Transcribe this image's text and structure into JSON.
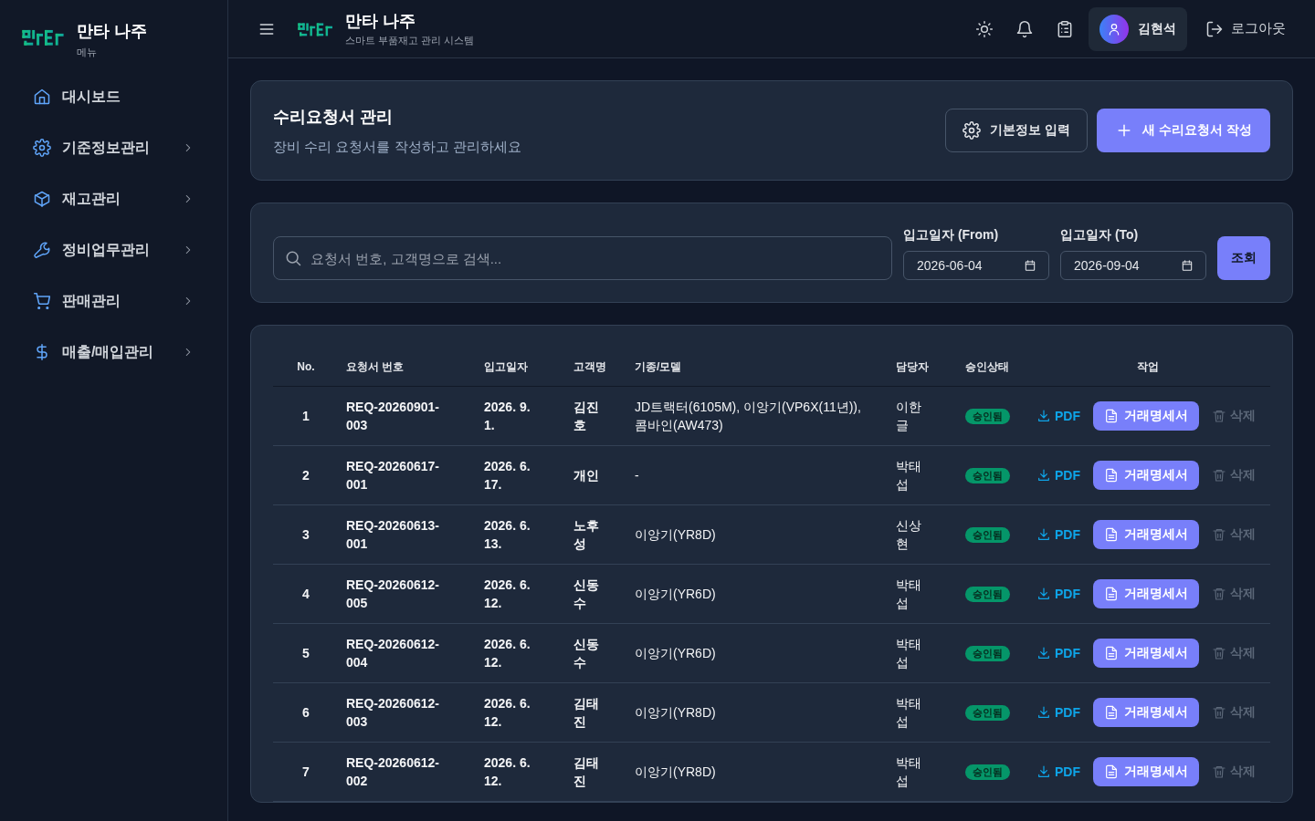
{
  "sidebar": {
    "brand": "만타 나주",
    "caption": "메뉴",
    "items": [
      {
        "label": "대시보드",
        "expandable": false
      },
      {
        "label": "기준정보관리",
        "expandable": true
      },
      {
        "label": "재고관리",
        "expandable": true
      },
      {
        "label": "정비업무관리",
        "expandable": true
      },
      {
        "label": "판매관리",
        "expandable": true
      },
      {
        "label": "매출/매입관리",
        "expandable": true
      }
    ]
  },
  "header": {
    "title": "만타 나주",
    "subtitle": "스마트 부품재고 관리 시스템",
    "user": "김현석",
    "logout": "로그아웃"
  },
  "page": {
    "title": "수리요청서 관리",
    "description": "장비 수리 요청서를 작성하고 관리하세요",
    "settings_button": "기본정보 입력",
    "new_button": "새 수리요청서 작성"
  },
  "filters": {
    "search": {
      "placeholder": "요청서 번호, 고객명으로 검색..."
    },
    "from": {
      "label": "입고일자 (From)",
      "value": "2026-06-04"
    },
    "to": {
      "label": "입고일자 (To)",
      "value": "2026-09-04"
    },
    "query_button": "조회"
  },
  "table": {
    "columns": [
      "No.",
      "요청서 번호",
      "입고일자",
      "고객명",
      "기종/모델",
      "담당자",
      "승인상태",
      "작업"
    ],
    "rows": [
      {
        "no": "1",
        "request": "REQ-20260901-003",
        "date": "2026. 9. 1.",
        "customer": "김진호",
        "model": "JD트랙터(6105M), 이앙기(VP6X(11년)), 콤바인(AW473)",
        "staff": "이한글",
        "status": "승인됨",
        "pdf": "PDF",
        "statement": "거래명세서",
        "delete": "삭제",
        "delete_disabled": true
      },
      {
        "no": "2",
        "request": "REQ-20260617-001",
        "date": "2026. 6. 17.",
        "customer": "개인",
        "model": "-",
        "staff": "박태섭",
        "status": "승인됨",
        "pdf": "PDF",
        "statement": "거래명세서",
        "delete": "삭제",
        "delete_disabled": true
      },
      {
        "no": "3",
        "request": "REQ-20260613-001",
        "date": "2026. 6. 13.",
        "customer": "노후성",
        "model": "이앙기(YR8D)",
        "staff": "신상현",
        "status": "승인됨",
        "pdf": "PDF",
        "statement": "거래명세서",
        "delete": "삭제",
        "delete_disabled": true
      },
      {
        "no": "4",
        "request": "REQ-20260612-005",
        "date": "2026. 6. 12.",
        "customer": "신동수",
        "model": "이앙기(YR6D)",
        "staff": "박태섭",
        "status": "승인됨",
        "pdf": "PDF",
        "statement": "거래명세서",
        "delete": "삭제",
        "delete_disabled": true
      },
      {
        "no": "5",
        "request": "REQ-20260612-004",
        "date": "2026. 6. 12.",
        "customer": "신동수",
        "model": "이앙기(YR6D)",
        "staff": "박태섭",
        "status": "승인됨",
        "pdf": "PDF",
        "statement": "거래명세서",
        "delete": "삭제",
        "delete_disabled": true
      },
      {
        "no": "6",
        "request": "REQ-20260612-003",
        "date": "2026. 6. 12.",
        "customer": "김태진",
        "model": "이앙기(YR8D)",
        "staff": "박태섭",
        "status": "승인됨",
        "pdf": "PDF",
        "statement": "거래명세서",
        "delete": "삭제",
        "delete_disabled": true
      },
      {
        "no": "7",
        "request": "REQ-20260612-002",
        "date": "2026. 6. 12.",
        "customer": "김태진",
        "model": "이앙기(YR8D)",
        "staff": "박태섭",
        "status": "승인됨",
        "pdf": "PDF",
        "statement": "거래명세서",
        "delete": "삭제",
        "delete_disabled": true
      }
    ]
  }
}
